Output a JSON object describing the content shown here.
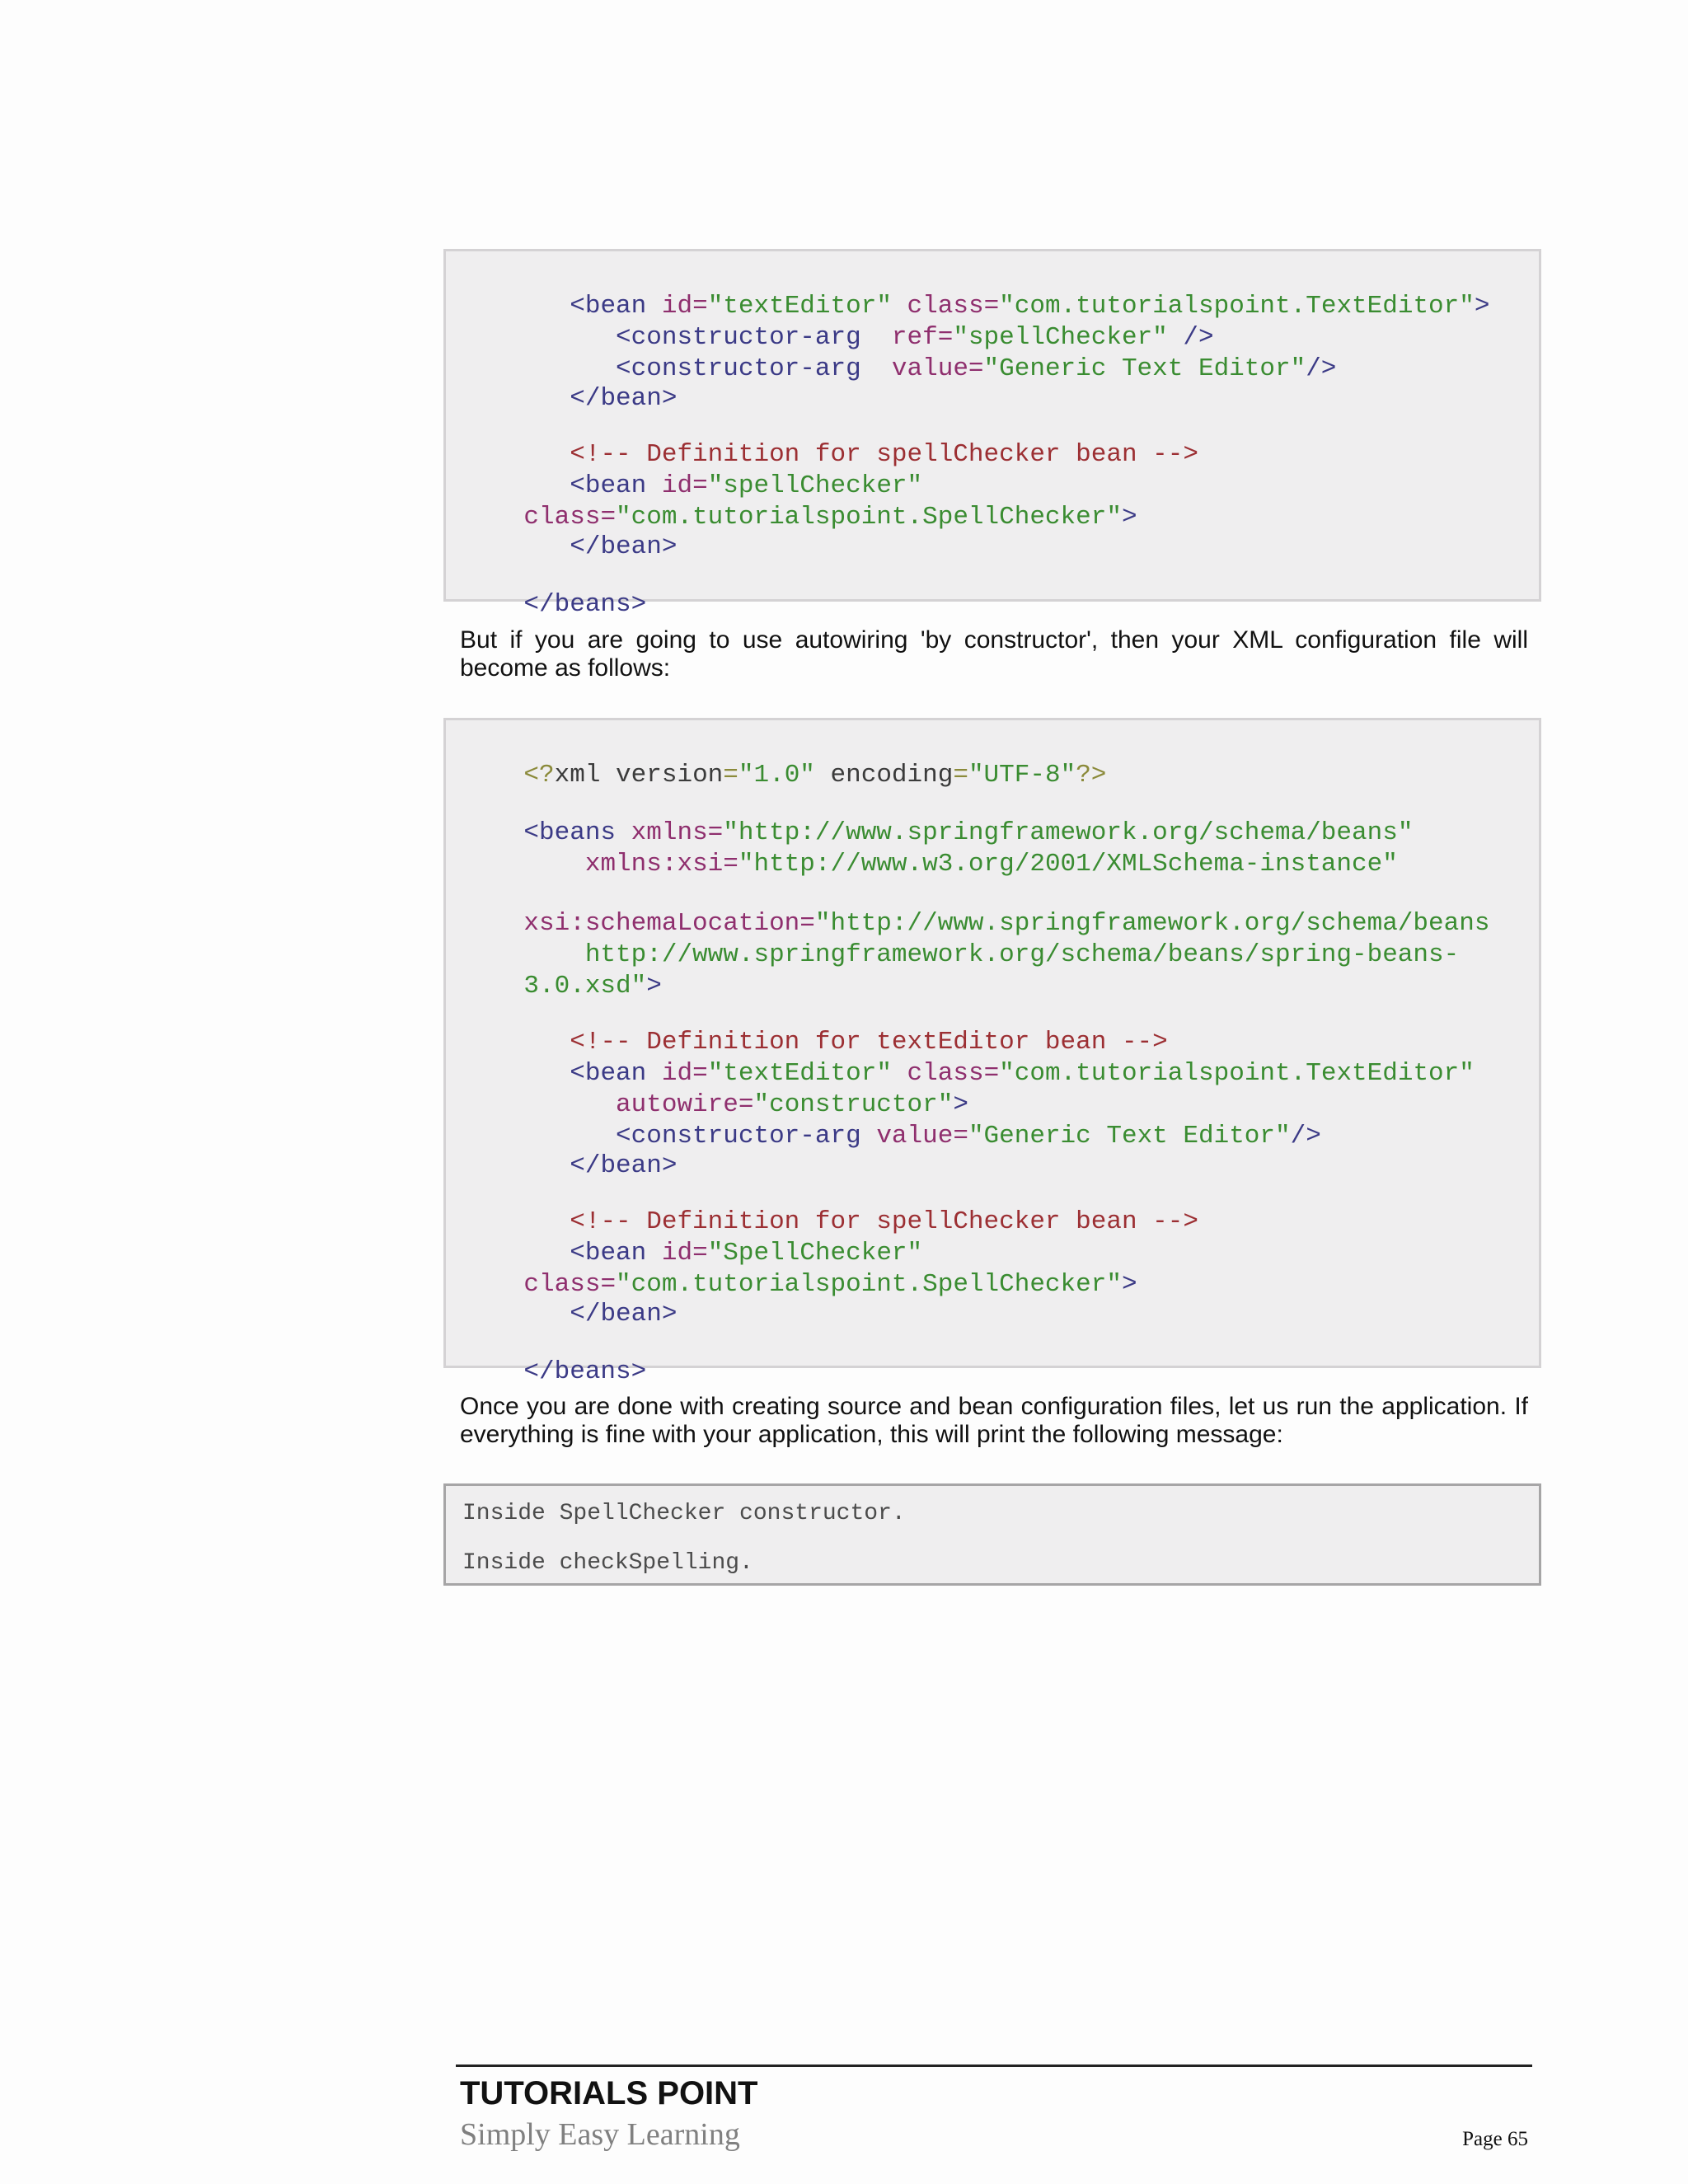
{
  "code_block_1": {
    "lines": [
      [
        "   ",
        "<bean ",
        "id",
        "=",
        "\"textEditor\"",
        " ",
        "class",
        "=",
        "\"com.tutorialspoint.TextEditor\"",
        ">"
      ],
      [
        "      ",
        "<constructor-arg  ",
        "ref",
        "=",
        "\"spellChecker\"",
        " />"
      ],
      [
        "      ",
        "<constructor-arg  ",
        "value",
        "=",
        "\"Generic Text Editor\"",
        "/>"
      ],
      [
        "   ",
        "</bean>"
      ],
      [
        "   ",
        "<!-- Definition for spellChecker bean -->"
      ],
      [
        "   ",
        "<bean ",
        "id",
        "=",
        "\"spellChecker\""
      ],
      [
        "class",
        "=",
        "\"com.tutorialspoint.SpellChecker\"",
        ">"
      ],
      [
        "   ",
        "</bean>"
      ],
      [
        "</beans>"
      ]
    ]
  },
  "paragraph_1": "But if you are going to use autowiring 'by constructor', then your XML configuration file will become as follows:",
  "code_block_2": {
    "lines": [
      [
        "<?",
        "xml version",
        "=",
        "\"1.0\"",
        " encoding",
        "=",
        "\"UTF-8\"",
        "?>"
      ],
      [
        "<beans ",
        "xmlns",
        "=",
        "\"http://www.springframework.org/schema/beans\""
      ],
      [
        "    ",
        "xmlns:xsi",
        "=",
        "\"http://www.w3.org/2001/XMLSchema-instance\""
      ],
      [
        "xsi:schemaLocation",
        "=",
        "\"http://www.springframework.org/schema/beans"
      ],
      [
        "    http://www.springframework.org/schema/beans/spring-beans-"
      ],
      [
        "3.0.xsd\"",
        ">"
      ],
      [
        "   ",
        "<!-- Definition for textEditor bean -->"
      ],
      [
        "   ",
        "<bean ",
        "id",
        "=",
        "\"textEditor\"",
        " ",
        "class",
        "=",
        "\"com.tutorialspoint.TextEditor\""
      ],
      [
        "      ",
        "autowire",
        "=",
        "\"constructor\"",
        ">"
      ],
      [
        "      ",
        "<constructor-arg ",
        "value",
        "=",
        "\"Generic Text Editor\"",
        "/>"
      ],
      [
        "   ",
        "</bean>"
      ],
      [
        "   ",
        "<!-- Definition for spellChecker bean -->"
      ],
      [
        "   ",
        "<bean ",
        "id",
        "=",
        "\"SpellChecker\""
      ],
      [
        "class",
        "=",
        "\"com.tutorialspoint.SpellChecker\"",
        ">"
      ],
      [
        "   ",
        "</bean>"
      ],
      [
        "</beans>"
      ]
    ]
  },
  "paragraph_2": "Once you are done with creating source and bean configuration files, let us run the application. If everything is fine with your application, this will print the following message:",
  "output_block": {
    "lines": [
      "Inside SpellChecker constructor.",
      "Inside checkSpelling."
    ]
  },
  "footer": {
    "brand": "TUTORIALS POINT",
    "tagline": "Simply Easy Learning",
    "page": "Page 65"
  }
}
